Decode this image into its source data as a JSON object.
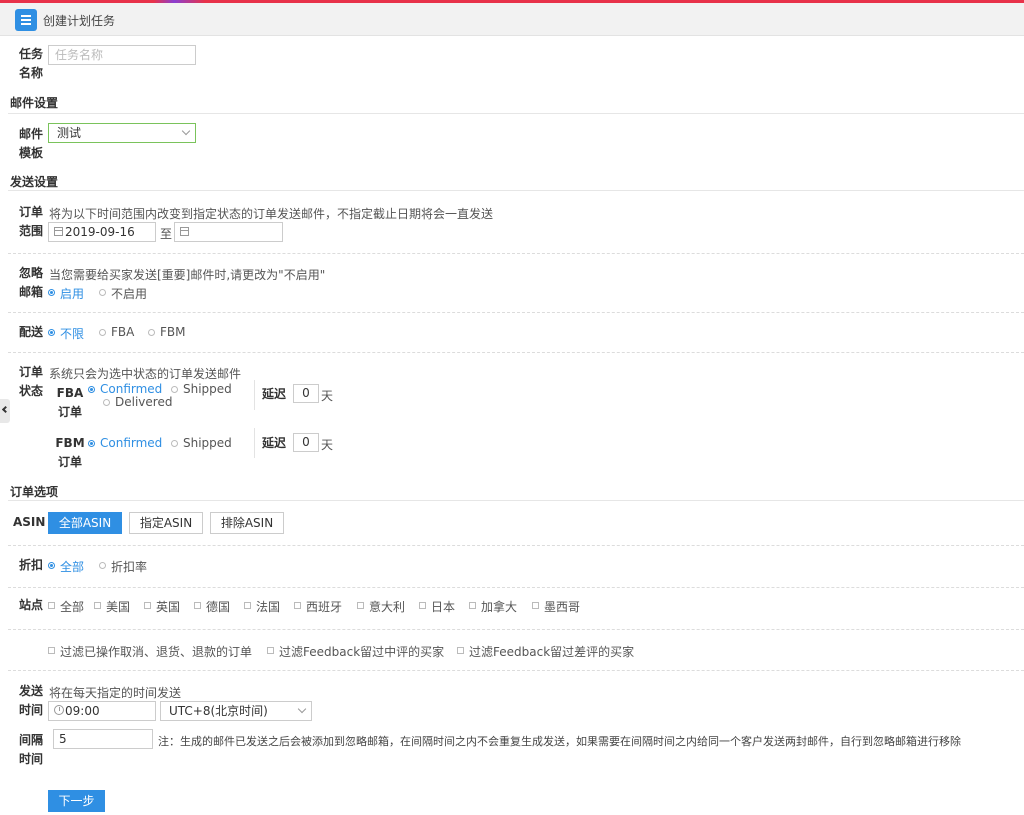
{
  "header": {
    "title": "创建计划任务"
  },
  "task_name": {
    "label_line1": "任务",
    "label_line2": "名称",
    "placeholder": "任务名称"
  },
  "mail_settings": {
    "section_title": "邮件设置",
    "template_label_line1": "邮件",
    "template_label_line2": "模板",
    "template_value": "测试"
  },
  "send_settings": {
    "section_title": "发送设置",
    "order_range": {
      "label_line1": "订单",
      "label_line2": "范围",
      "hint": "将为以下时间范围内改变到指定状态的订单发送邮件，不指定截止日期将会一直发送",
      "start_date": "2019-09-16",
      "to_text": "至",
      "end_date": ""
    },
    "ignore_mailbox": {
      "label_line1": "忽略",
      "label_line2": "邮箱",
      "hint": "当您需要给买家发送[重要]邮件时,请更改为\"不启用\"",
      "options": [
        "启用",
        "不启用"
      ],
      "selected": "启用"
    },
    "delivery": {
      "label": "配送",
      "options": [
        "不限",
        "FBA",
        "FBM"
      ],
      "selected": "不限"
    },
    "order_status": {
      "label_line1": "订单",
      "label_line2": "状态",
      "hint": "系统只会为选中状态的订单发送邮件",
      "fba": {
        "label_line1": "FBA",
        "label_line2": "订单",
        "options": [
          "Confirmed",
          "Shipped",
          "Delivered"
        ],
        "selected": "Confirmed",
        "delay_label": "延迟",
        "delay_value": "0",
        "delay_unit": "天"
      },
      "fbm": {
        "label_line1": "FBM",
        "label_line2": "订单",
        "options": [
          "Confirmed",
          "Shipped"
        ],
        "selected": "Confirmed",
        "delay_label": "延迟",
        "delay_value": "0",
        "delay_unit": "天"
      }
    }
  },
  "order_options": {
    "section_title": "订单选项",
    "asin": {
      "label": "ASIN",
      "buttons": [
        "全部ASIN",
        "指定ASIN",
        "排除ASIN"
      ],
      "selected": "全部ASIN"
    },
    "discount": {
      "label": "折扣",
      "options": [
        "全部",
        "折扣率"
      ],
      "selected": "全部"
    },
    "sites": {
      "label": "站点",
      "options": [
        "全部",
        "美国",
        "英国",
        "德国",
        "法国",
        "西班牙",
        "意大利",
        "日本",
        "加拿大",
        "墨西哥"
      ]
    },
    "filters": [
      "过滤已操作取消、退货、退款的订单",
      "过滤Feedback留过中评的买家",
      "过滤Feedback留过差评的买家"
    ],
    "send_time": {
      "label_line1": "发送",
      "label_line2": "时间",
      "hint": "将在每天指定的时间发送",
      "time": "09:00",
      "timezone": "UTC+8(北京时间)"
    },
    "interval": {
      "label_line1": "间隔",
      "label_line2": "时间",
      "value": "5",
      "note": "注：生成的邮件已发送之后会被添加到忽略邮箱，在间隔时间之内不会重复生成发送，如果需要在间隔时间之内给同一个客户发送两封邮件，自行到忽略邮箱进行移除"
    }
  },
  "next_button": "下一步",
  "colors": {
    "accent": "#2f8fe3",
    "header_bg": "#f2f2f2",
    "select_border": "#7ac35b"
  }
}
